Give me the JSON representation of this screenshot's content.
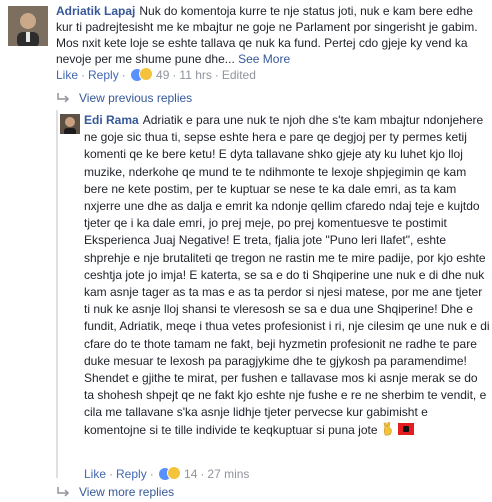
{
  "comment": {
    "author": "Adriatik Lapaj",
    "text": "Nuk do komentoja kurre te nje status joti, nuk e kam bere edhe kur ti padrejtesisht me ke mbajtur ne goje ne Parlament por singerisht je gabim. Mos nxit kete loje se eshte tallava qe nuk ka fund. Pertej cdo gjeje ky vend ka nevoje per me shume pune dhe...",
    "see_more": "See More",
    "like": "Like",
    "reply": "Reply",
    "reaction_count": "49",
    "time": "11 hrs",
    "edited": "Edited"
  },
  "view_previous": "View previous replies",
  "reply_comment": {
    "author": "Edi Rama",
    "text": "Adriatik e para une nuk te njoh dhe s'te kam mbajtur ndonjehere ne goje sic thua ti, sepse eshte hera e pare qe degjoj per ty permes ketij komenti qe ke bere ketu! E dyta tallavane shko gjeje aty ku luhet kjo lloj muzike, nderkohe qe mund te te ndihmonte te lexoje shpjegimin qe kam bere ne kete postim, per te kuptuar se nese te ka dale emri, as ta kam nxjerre une dhe as dalja e emrit ka ndonje qellim cfaredo ndaj teje e kujtdo tjeter qe i ka dale emri, jo prej meje, po prej komentuesve te postimit Eksperienca Juaj Negative! E treta, fjalia jote \"Puno leri llafet\", eshte shprehje e nje brutaliteti qe tregon ne rastin me te mire padije, por kjo eshte ceshtja jote jo imja! E katerta, se sa e do ti Shqiperine une nuk e di dhe nuk kam asnje tager as ta mas e as ta perdor si njesi matese, por me ane tjeter ti nuk ke asnje lloj shansi te vleresosh se sa e dua une Shqiperine! Dhe e fundit, Adriatik, meqe i thua vetes profesionist i ri, nje cilesim qe une nuk e di cfare do te thote tamam ne fakt, beji hyzmetin profesionit ne radhe te pare duke mesuar te lexosh pa paragjykime dhe te gjykosh pa paramendime! Shendet e gjithe te mirat, per fushen e tallavase mos ki asnje merak se do ta shohesh shpejt qe ne fakt kjo eshte nje fushe e re ne sherbim te vendit, e cila me tallavane s'ka asnje lidhje tjeter pervecse kur gabimisht e komentojne si te tille individe te keqkuptuar si puna jote",
    "like": "Like",
    "reply": "Reply",
    "reaction_count": "14",
    "time": "27 mins"
  },
  "view_more": "View more replies",
  "colors": {
    "link": "#365899",
    "meta": "#90949c",
    "text": "#1d2129"
  }
}
